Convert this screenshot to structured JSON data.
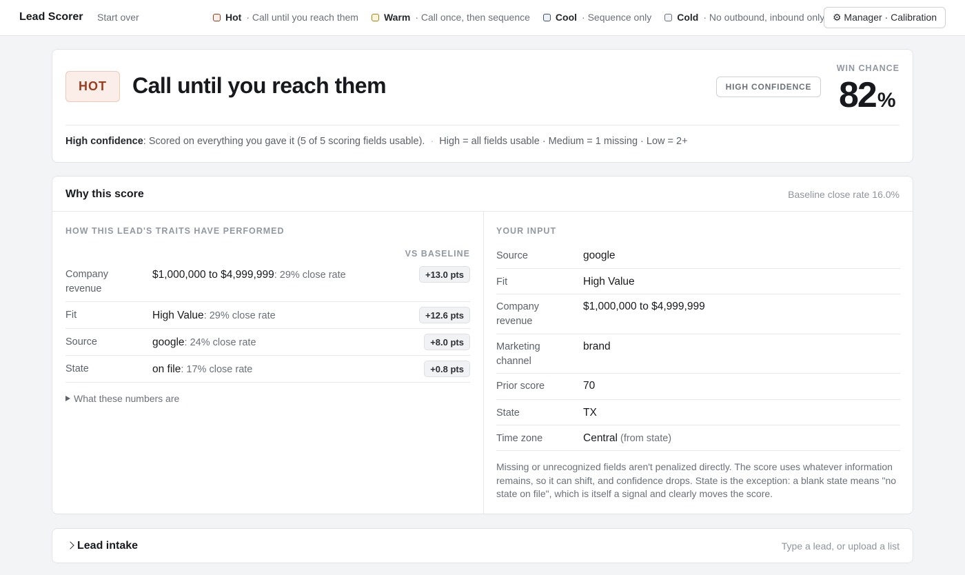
{
  "topbar": {
    "brand": "Lead Scorer",
    "start_over": "Start over",
    "legend": [
      {
        "name": "Hot",
        "desc": "· Call until you reach them",
        "color": "#9a3d1e",
        "fill": "#fbeee8"
      },
      {
        "name": "Warm",
        "desc": "· Call once, then sequence",
        "color": "#a88418",
        "fill": "#fbf4dc"
      },
      {
        "name": "Cool",
        "desc": "· Sequence only",
        "color": "#3d5270",
        "fill": "#eef2f8"
      },
      {
        "name": "Cold",
        "desc": "· No outbound, inbound only",
        "color": "#6b7079",
        "fill": "#f3f4f6"
      }
    ],
    "manager_button": "⚙ Manager · Calibration"
  },
  "hero": {
    "tier": "HOT",
    "title": "Call until you reach them",
    "confidence_badge": "HIGH CONFIDENCE",
    "win_label": "WIN CHANCE",
    "win_value": "82",
    "win_unit": "%",
    "confidence_bold": "High confidence",
    "confidence_text": ": Scored on everything you gave it (5 of 5 scoring fields usable).",
    "confidence_sep": "·",
    "confidence_legend": "High = all fields usable · Medium = 1 missing · Low = 2+"
  },
  "why": {
    "title": "Why this score",
    "baseline": "Baseline close rate 16.0%",
    "traits_label": "HOW THIS LEAD'S TRAITS HAVE PERFORMED",
    "vs_label": "VS BASELINE",
    "traits": [
      {
        "label": "Company revenue",
        "value": "$1,000,000 to $4,999,999",
        "rate": ": 29% close rate",
        "pts": "+13.0 pts"
      },
      {
        "label": "Fit",
        "value": "High Value",
        "rate": ": 29% close rate",
        "pts": "+12.6 pts"
      },
      {
        "label": "Source",
        "value": "google",
        "rate": ": 24% close rate",
        "pts": "+8.0 pts"
      },
      {
        "label": "State",
        "value": "on file",
        "rate": ": 17% close rate",
        "pts": "+0.8 pts"
      }
    ],
    "details_toggle": "What these numbers are",
    "input_label": "YOUR INPUT",
    "inputs": [
      {
        "label": "Source",
        "value": "google",
        "sub": ""
      },
      {
        "label": "Fit",
        "value": "High Value",
        "sub": ""
      },
      {
        "label": "Company revenue",
        "value": "$1,000,000 to $4,999,999",
        "sub": ""
      },
      {
        "label": "Marketing channel",
        "value": "brand",
        "sub": ""
      },
      {
        "label": "Prior score",
        "value": "70",
        "sub": ""
      },
      {
        "label": "State",
        "value": "TX",
        "sub": ""
      },
      {
        "label": "Time zone",
        "value": "Central",
        "sub": " (from state)"
      }
    ],
    "note": "Missing or unrecognized fields aren't penalized directly. The score uses whatever information remains, so it can shift, and confidence drops. State is the exception: a blank state means \"no state on file\", which is itself a signal and clearly moves the score."
  },
  "intake": {
    "title": "Lead intake",
    "hint": "Type a lead, or upload a list"
  }
}
